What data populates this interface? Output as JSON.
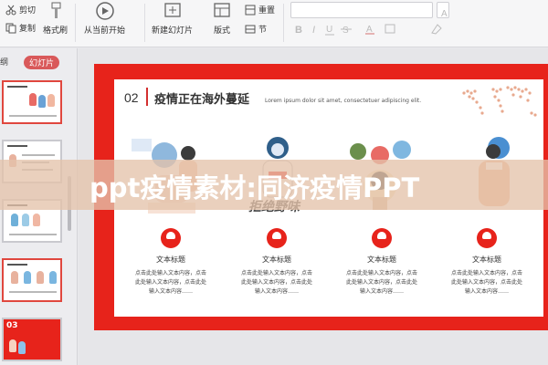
{
  "ribbon": {
    "cut": "剪切",
    "copy": "复制",
    "format_painter": "格式刷",
    "from_current": "从当前开始",
    "new_slide": "新建幻灯片",
    "layout": "版式",
    "reset": "重置",
    "section": "节"
  },
  "left_panel": {
    "tab_outline": "纲",
    "tab_slides": "幻灯片",
    "thumb_badge": "03"
  },
  "slide": {
    "number": "02",
    "title": "疫情正在海外蔓延",
    "subtitle": "Lorem ipsum dolor sit amet, consectetuer adipiscing elit.",
    "brush_text": "拒绝野味",
    "features": [
      {
        "label": "文本标题",
        "body": "点击此处输入文本内容，点击此处输入文本内容，点击此处输入文本内容……"
      },
      {
        "label": "文本标题",
        "body": "点击此处输入文本内容，点击此处输入文本内容，点击此处输入文本内容……"
      },
      {
        "label": "文本标题",
        "body": "点击此处输入文本内容，点击此处输入文本内容，点击此处输入文本内容……"
      },
      {
        "label": "文本标题",
        "body": "点击此处输入文本内容，点击此处输入文本内容，点击此处输入文本内容……"
      }
    ]
  },
  "watermark": {
    "text": "ppt疫情素材:同济疫情PPT"
  },
  "colors": {
    "accent": "#e7231b",
    "tab_active": "#d9595a"
  }
}
